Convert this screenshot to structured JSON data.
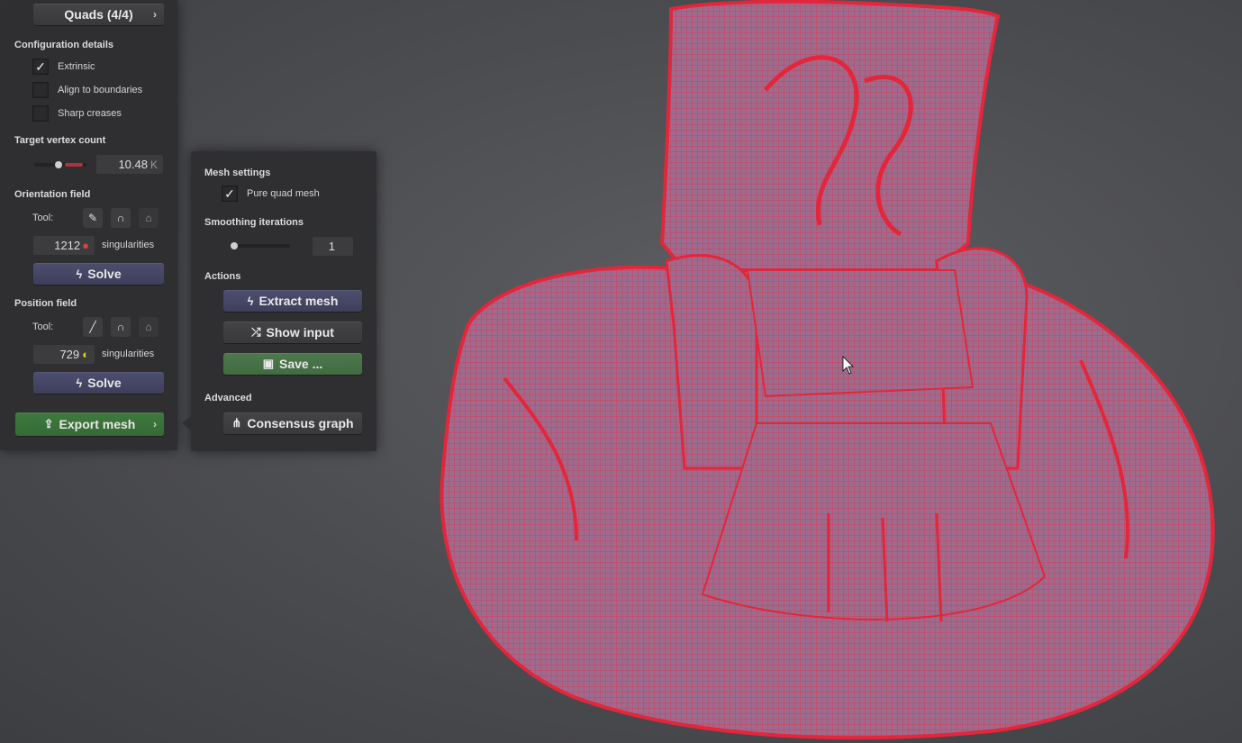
{
  "mode_button": {
    "label": "Quads (4/4)"
  },
  "config": {
    "title": "Configuration details",
    "extrinsic": {
      "label": "Extrinsic",
      "checked": true
    },
    "align": {
      "label": "Align to boundaries",
      "checked": false
    },
    "creases": {
      "label": "Sharp creases",
      "checked": false
    }
  },
  "vertex": {
    "title": "Target vertex count",
    "value": "10.48",
    "unit": "K",
    "slider_level": 0.5
  },
  "orientation": {
    "title": "Orientation field",
    "tool_label": "Tool:",
    "count": "1212",
    "singularities_label": "singularities",
    "solve_label": "Solve"
  },
  "position": {
    "title": "Position field",
    "tool_label": "Tool:",
    "count": "729",
    "singularities_label": "singularities",
    "solve_label": "Solve"
  },
  "export": {
    "label": "Export mesh"
  },
  "mesh_settings": {
    "title": "Mesh settings",
    "pure_quad": {
      "label": "Pure quad mesh",
      "checked": true
    },
    "smoothing_title": "Smoothing iterations",
    "smoothing_value": "1",
    "actions_title": "Actions",
    "extract_label": "Extract mesh",
    "show_input_label": "Show input",
    "save_label": "Save ...",
    "advanced_title": "Advanced",
    "consensus_label": "Consensus graph"
  },
  "colors": {
    "mesh_red": "#e5253a",
    "mesh_fill": "#9a6a8c",
    "panel": "#2f2f31",
    "blue_button": "#46466a",
    "green_button": "#3a733a"
  },
  "icons": [
    "chevron-right-icon",
    "checkmark-icon",
    "brush-icon",
    "magnet-icon",
    "ghost-icon",
    "pencil-icon",
    "lightning-icon",
    "export-icon",
    "shuffle-icon",
    "floppy-icon",
    "graph-icon",
    "cursor-icon"
  ]
}
